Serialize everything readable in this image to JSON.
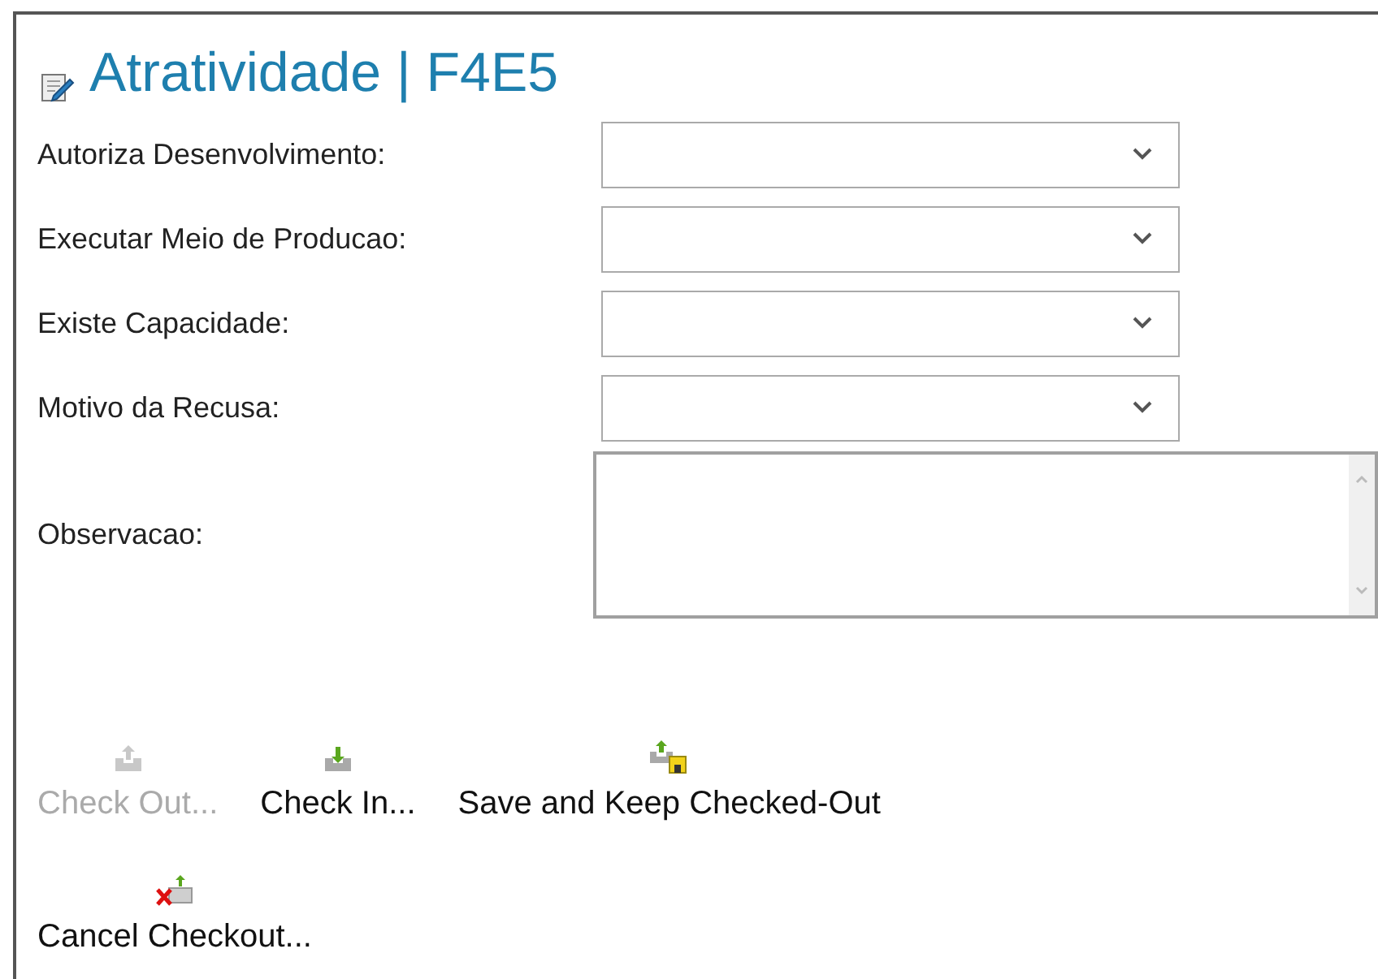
{
  "title": "Atratividade | F4E5",
  "fields": [
    {
      "label": "Autoriza Desenvolvimento:",
      "kind": "dropdown"
    },
    {
      "label": "Executar Meio de Producao:",
      "kind": "dropdown"
    },
    {
      "label": "Existe Capacidade:",
      "kind": "dropdown"
    },
    {
      "label": "Motivo da Recusa:",
      "kind": "dropdown"
    },
    {
      "label": "Observacao:",
      "kind": "textarea"
    }
  ],
  "actions": [
    {
      "label": "Check Out...",
      "kind": "check_out",
      "disabled": true
    },
    {
      "label": "Check In...",
      "kind": "check_in",
      "disabled": false
    },
    {
      "label": "Save and Keep Checked-Out",
      "kind": "save_keep",
      "disabled": false
    },
    {
      "label": "Cancel Checkout...",
      "kind": "cancel",
      "disabled": false
    }
  ]
}
